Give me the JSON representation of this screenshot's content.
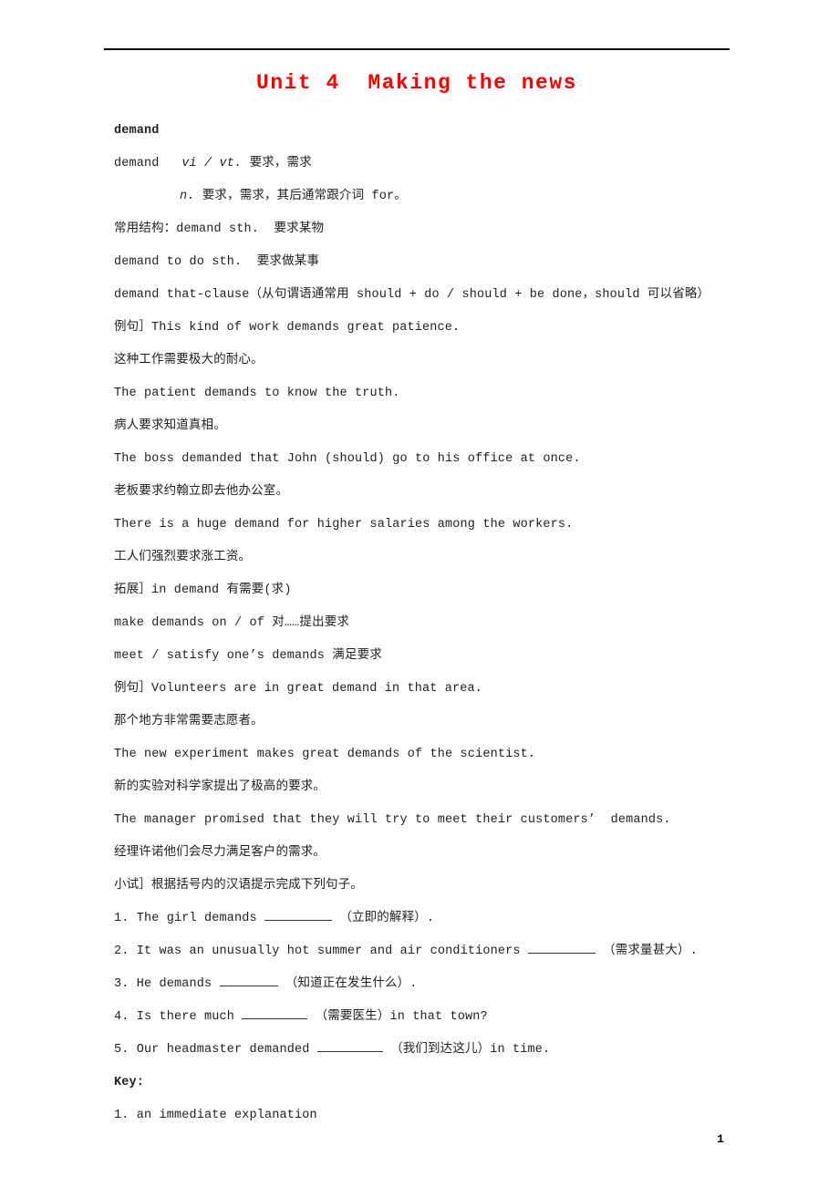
{
  "document": {
    "title": "Unit 4  Making the news",
    "title_color": "#ff0000",
    "page_number": "1",
    "headword": "demand",
    "entry": {
      "line1_word": "demand",
      "line1_pos": "vi / vt.",
      "line1_gloss": "要求，需求",
      "line2_pos": "n.",
      "line2_gloss": "要求，需求，其后通常跟介词 for。"
    },
    "structures": {
      "label_line": "常用结构：demand sth.  要求某物",
      "items": [
        "demand to do sth.  要求做某事",
        "demand that-clause（从句谓语通常用 should + do / should + be done，should 可以省略）"
      ]
    },
    "examples_1": [
      "例句］This kind of work demands great patience.",
      "这种工作需要极大的耐心。",
      "The patient demands to know the truth.",
      "病人要求知道真相。",
      "The boss demanded that John (should) go to his office at once.",
      "老板要求约翰立即去他办公室。",
      "There is a huge demand for higher salaries among the workers.",
      "工人们强烈要求涨工资。"
    ],
    "extension": {
      "label_line": "拓展］in demand 有需要(求)",
      "items": [
        "make demands on / of 对……提出要求",
        "meet / satisfy one’s demands 满足要求"
      ]
    },
    "examples_2": [
      "例句］Volunteers are in great demand in that area.",
      "那个地方非常需要志愿者。",
      "The new experiment makes great demands of the scientist.",
      "新的实验对科学家提出了极高的要求。",
      "The manager promised that they will try to meet their customers’  demands.",
      "经理许诺他们会尽力满足客户的需求。"
    ],
    "exercise": {
      "instruction": "小试］根据括号内的汉语提示完成下列句子。",
      "questions": [
        {
          "number": "1.",
          "before": "The girl demands ",
          "after": " （立即的解释）."
        },
        {
          "number": "2.",
          "before": "It was an unusually hot summer and air conditioners ",
          "after": " （需求量甚大）."
        },
        {
          "number": "3.",
          "before": "He demands ",
          "after": " （知道正在发生什么）."
        },
        {
          "number": "4.",
          "before": "Is there much ",
          "after": " （需要医生）in that town?"
        },
        {
          "number": "5.",
          "before": "Our headmaster demanded ",
          "after": " （我们到达这儿）in time."
        }
      ]
    },
    "key": {
      "heading": "Key:",
      "answers": [
        "1. an immediate explanation"
      ]
    }
  }
}
